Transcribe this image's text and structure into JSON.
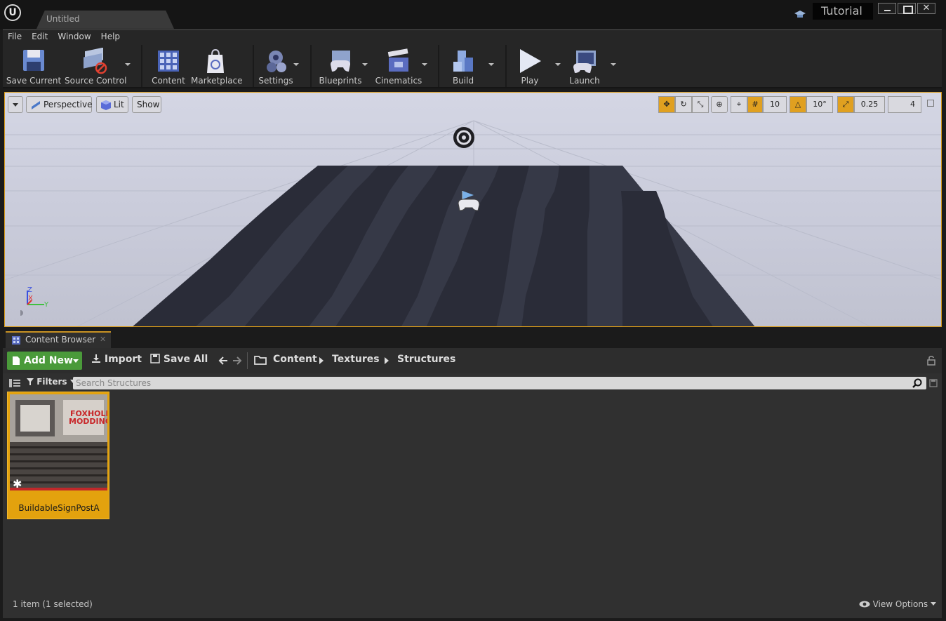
{
  "window": {
    "tab_title": "Untitled",
    "tutorial_label": "Tutorial",
    "close_glyph": "✕"
  },
  "menu": [
    "File",
    "Edit",
    "Window",
    "Help"
  ],
  "toolbar": {
    "save_current": "Save Current",
    "source_control": "Source Control",
    "content": "Content",
    "marketplace": "Marketplace",
    "settings": "Settings",
    "blueprints": "Blueprints",
    "cinematics": "Cinematics",
    "build": "Build",
    "play": "Play",
    "launch": "Launch"
  },
  "viewport": {
    "perspective": "Perspective",
    "lit": "Lit",
    "show": "Show",
    "grid_snap": "10",
    "rotation_snap": "10°",
    "scale_snap": "0.25",
    "camera_speed": "4",
    "axis_z": "Z",
    "axis_x": "X",
    "axis_y": "Y"
  },
  "content_browser": {
    "tab_label": "Content Browser",
    "close_glyph": "✕",
    "add_new": "Add New",
    "import": "Import",
    "save_all": "Save All",
    "breadcrumb": [
      "Content",
      "Textures",
      "Structures"
    ],
    "filters": "Filters",
    "search_placeholder": "Search Structures",
    "assets": [
      {
        "name": "BuildableSignPostA",
        "thumb_text_1": "FOXHOLE",
        "thumb_text_2": "MODDING"
      }
    ],
    "status": "1 item (1 selected)",
    "view_options": "View Options"
  },
  "colors": {
    "selection": "#e3a20e",
    "add_new_green": "#4a9a3a",
    "viewport_border": "#d99b1a"
  }
}
